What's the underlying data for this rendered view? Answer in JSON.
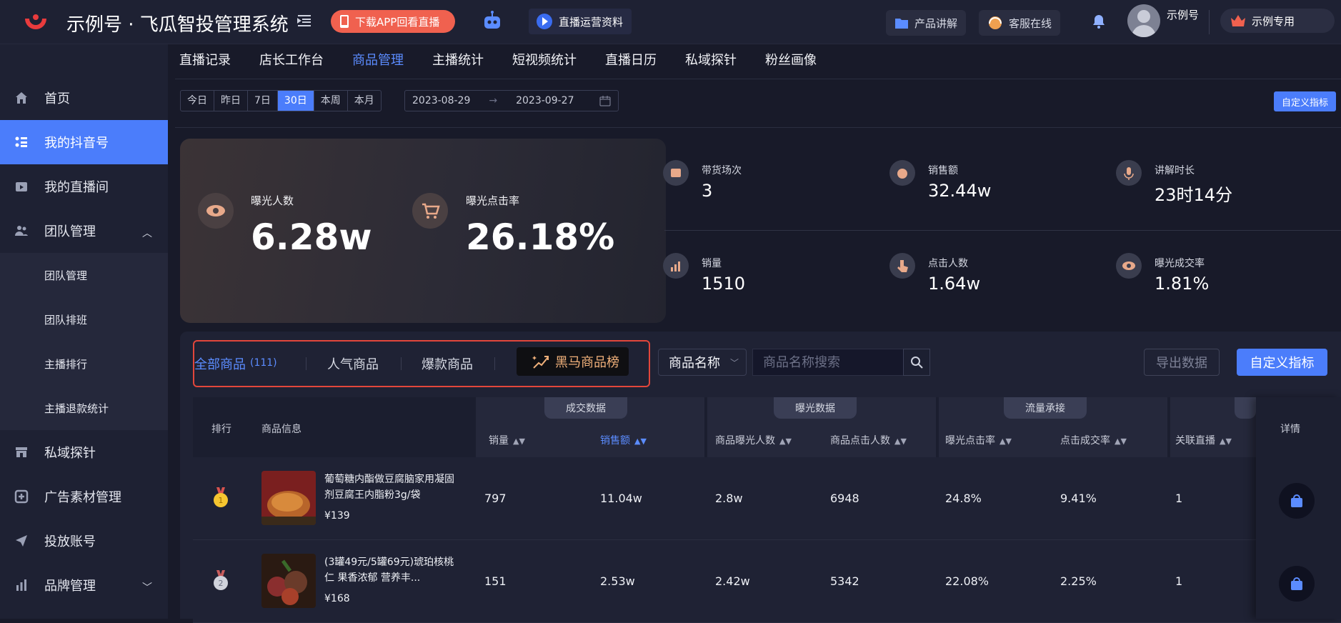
{
  "header": {
    "app_title": "示例号 · 飞瓜智投管理系统",
    "download_label": "下载APP回看直播",
    "live_docs_label": "直播运营资料",
    "product_intro_label": "产品讲解",
    "service_label": "客服在线",
    "username": "示例号",
    "vip_label": "示例专用"
  },
  "sidebar": {
    "items": [
      {
        "label": "首页"
      },
      {
        "label": "我的抖音号"
      },
      {
        "label": "我的直播间"
      },
      {
        "label": "团队管理"
      },
      {
        "label": "团队管理"
      },
      {
        "label": "团队排班"
      },
      {
        "label": "主播排行"
      },
      {
        "label": "主播退款统计"
      },
      {
        "label": "私域探针"
      },
      {
        "label": "广告素材管理"
      },
      {
        "label": "投放账号"
      },
      {
        "label": "品牌管理"
      }
    ]
  },
  "tabs": [
    "直播记录",
    "店长工作台",
    "商品管理",
    "主播统计",
    "短视频统计",
    "直播日历",
    "私域探针",
    "粉丝画像"
  ],
  "date_filter": {
    "options": [
      "今日",
      "昨日",
      "7日",
      "30日",
      "本周",
      "本月"
    ],
    "selected": "30日",
    "start": "2023-08-29",
    "end": "2023-09-27",
    "custom_label": "自定义指标"
  },
  "hero": {
    "exposure_label": "曝光人数",
    "exposure_value": "6.28w",
    "ctr_label": "曝光点击率",
    "ctr_value": "26.18%"
  },
  "metrics": [
    {
      "label": "带货场次",
      "value": "3"
    },
    {
      "label": "销售额",
      "value": "32.44w"
    },
    {
      "label": "讲解时长",
      "value": "23时14分"
    },
    {
      "label": "销量",
      "value": "1510"
    },
    {
      "label": "点击人数",
      "value": "1.64w"
    },
    {
      "label": "曝光成交率",
      "value": "1.81%"
    }
  ],
  "product_tabs": {
    "all_label": "全部商品",
    "all_count": "(111)",
    "popular_label": "人气商品",
    "hot_label": "爆款商品",
    "dark_horse_label": "黑马商品榜"
  },
  "search": {
    "field_label": "商品名称",
    "placeholder": "商品名称搜索",
    "export_label": "导出数据",
    "custom_label": "自定义指标"
  },
  "table": {
    "rank_header": "排行",
    "info_header": "商品信息",
    "groups": [
      "成交数据",
      "曝光数据",
      "流量承接"
    ],
    "columns": [
      "销量",
      "销售额",
      "商品曝光人数",
      "商品点击人数",
      "曝光点击率",
      "点击成交率",
      "关联直播"
    ],
    "detail_header": "详情",
    "rows": [
      {
        "name": "葡萄糖内酯做豆腐脑家用凝固剂豆腐王内脂粉3g/袋",
        "price": "¥139",
        "sales": "797",
        "amount": "11.04w",
        "exposure": "2.8w",
        "clicks": "6948",
        "ctr": "24.8%",
        "cvr": "9.41%",
        "lives": "1"
      },
      {
        "name": "(3罐49元/5罐69元)琥珀核桃仁 果香浓郁 营养丰...",
        "price": "¥168",
        "sales": "151",
        "amount": "2.53w",
        "exposure": "2.42w",
        "clicks": "5342",
        "ctr": "22.08%",
        "cvr": "2.25%",
        "lives": "1"
      }
    ]
  }
}
